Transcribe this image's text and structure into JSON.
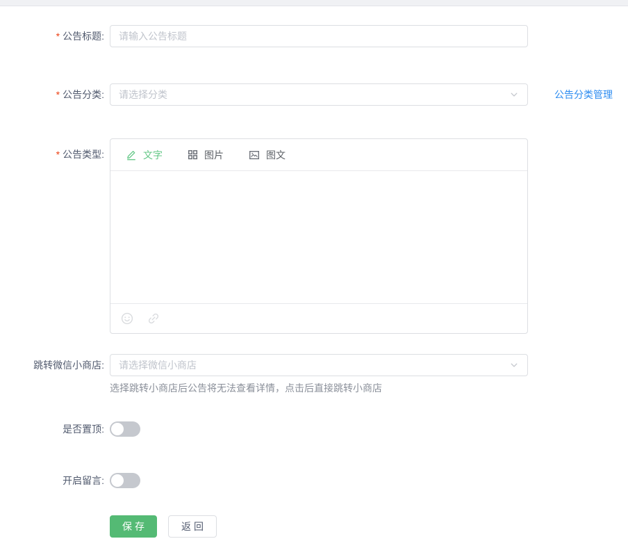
{
  "colors": {
    "primary_green": "#54ba74",
    "tab_active_green": "#63c786",
    "link_blue": "#2d8cf0",
    "required_red": "#ed4014",
    "switch_off_gray": "#c5c8ce",
    "border_gray": "#dcdee2",
    "placeholder_gray": "#c0c4cc"
  },
  "form": {
    "title": {
      "required_mark": "*",
      "label": "公告标题:",
      "placeholder": "请输入公告标题"
    },
    "category": {
      "required_mark": "*",
      "label": "公告分类:",
      "placeholder": "请选择分类",
      "manage_link": "公告分类管理"
    },
    "type": {
      "required_mark": "*",
      "label": "公告类型:",
      "tabs": [
        {
          "label": "文字",
          "icon": "pencil-icon",
          "active": true
        },
        {
          "label": "图片",
          "icon": "grid-icon",
          "active": false
        },
        {
          "label": "图文",
          "icon": "image-text-icon",
          "active": false
        }
      ],
      "toolbar_icons": [
        "emoji-icon",
        "link-icon"
      ],
      "content": ""
    },
    "mini_store": {
      "label": "跳转微信小商店:",
      "placeholder": "请选择微信小商店",
      "help": "选择跳转小商店后公告将无法查看详情，点击后直接跳转小商店"
    },
    "pin": {
      "label": "是否置顶:",
      "state": "off"
    },
    "message": {
      "label": "开启留言:",
      "state": "off"
    },
    "actions": {
      "save": "保存",
      "back": "返回"
    }
  }
}
